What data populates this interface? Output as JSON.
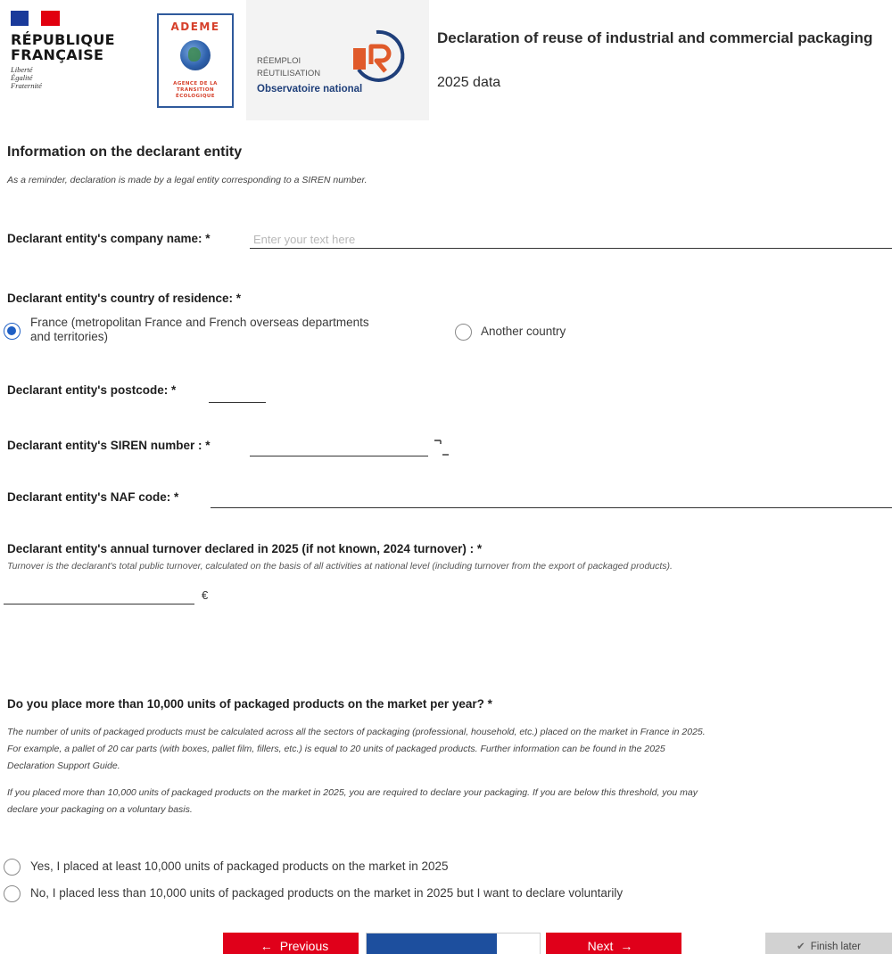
{
  "header": {
    "rf_name_line1": "RÉPUBLIQUE",
    "rf_name_line2": "FRANÇAISE",
    "rf_motto_1": "Liberté",
    "rf_motto_2": "Égalité",
    "rf_motto_3": "Fraternité",
    "ademe_title": "ADEME",
    "ademe_sub_1": "AGENCE DE LA",
    "ademe_sub_2": "TRANSITION",
    "ademe_sub_3": "ÉCOLOGIQUE",
    "obs_line1": "RÉEMPLOI",
    "obs_line2": "RÉUTILISATION",
    "obs_line3": "Observatoire national",
    "title": "Declaration of reuse of industrial and commercial packaging",
    "subtitle": "2025 data"
  },
  "section": {
    "title": "Information on the declarant entity",
    "reminder": "As a reminder, declaration is made by a legal entity corresponding to a SIREN number."
  },
  "fields": {
    "company_name_label": "Declarant entity's company name: *",
    "company_name_placeholder": "Enter your text here",
    "company_name_value": "",
    "country_label": "Declarant entity's country of residence: *",
    "country_option_france_1": "France (metropolitan France and French overseas departments",
    "country_option_france_2": "and territories)",
    "country_option_other": "Another country",
    "country_selected": "France",
    "postcode_label": "Declarant entity's postcode: *",
    "postcode_value": "",
    "siren_label": "Declarant entity's SIREN number : *",
    "siren_value": "",
    "naf_label": "Declarant entity's NAF code: *",
    "naf_value": "",
    "turnover_label": "Declarant entity's annual turnover declared in 2025 (if not known, 2024 turnover) : *",
    "turnover_hint": "Turnover is the declarant's total public turnover, calculated on the basis of all activities at national level (including turnover from the export of packaged products).",
    "turnover_value": "",
    "turnover_unit": "€"
  },
  "question": {
    "title": "Do you place more than 10,000 units of packaged products on the market per year? *",
    "para1_line1": "The number of units of packaged products must be calculated across all the sectors of packaging (professional, household, etc.) placed on the market in France in 2025.",
    "para1_line2": "For example, a pallet of 20 car parts (with boxes, pallet film, fillers, etc.) is equal to 20 units of packaged products. Further information can be found in the 2025",
    "para1_line3": "Declaration Support Guide.",
    "para2_line1": "If you placed more than 10,000 units of packaged products on the market in 2025, you are required to declare your packaging. If you are below this threshold, you may",
    "para2_line2": "declare your packaging on a voluntary basis.",
    "option_yes": "Yes, I placed at least 10,000 units of packaged products on the market in 2025",
    "option_no": "No, I placed less than 10,000 units of packaged products on the market in 2025 but I want to declare voluntarily"
  },
  "nav": {
    "previous_label": "Previous",
    "next_label": "Next",
    "finish_later_label": "Finish later",
    "progress_fraction": 0.75
  },
  "colors": {
    "accent_red": "#e0001a",
    "progress_blue": "#1d4f9e",
    "radio_blue": "#1f5fc4"
  }
}
